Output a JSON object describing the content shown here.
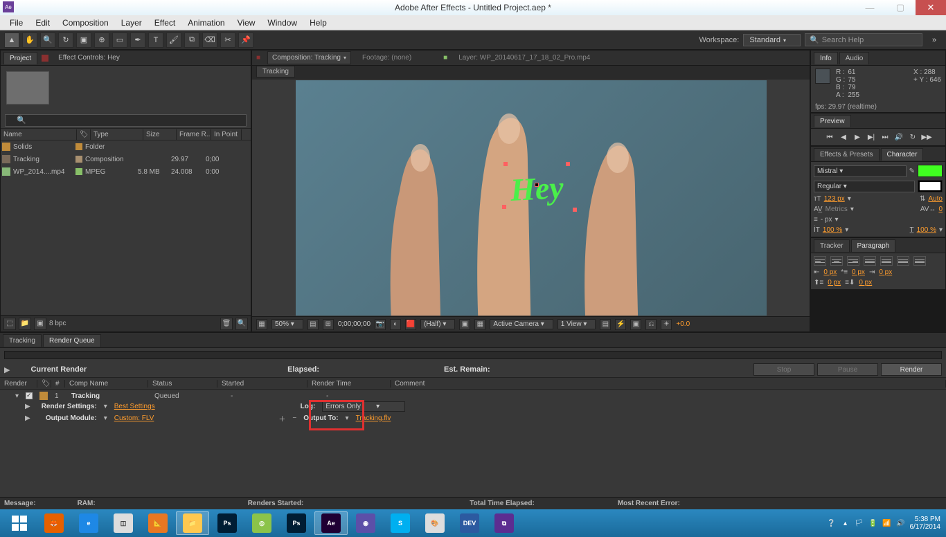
{
  "window": {
    "title": "Adobe After Effects - Untitled Project.aep *"
  },
  "menubar": [
    "File",
    "Edit",
    "Composition",
    "Layer",
    "Effect",
    "Animation",
    "View",
    "Window",
    "Help"
  ],
  "workspace": {
    "label": "Workspace:",
    "value": "Standard"
  },
  "search": {
    "placeholder": "Search Help"
  },
  "project": {
    "tabs": [
      "Project",
      "Effect Controls: Hey"
    ],
    "columns": [
      "Name",
      "",
      "Type",
      "Size",
      "Frame R...",
      "In Point"
    ],
    "rows": [
      {
        "name": "Solids",
        "type": "Folder",
        "size": "",
        "fps": "",
        "in": ""
      },
      {
        "name": "Tracking",
        "type": "Composition",
        "size": "",
        "fps": "29.97",
        "in": "0;00"
      },
      {
        "name": "WP_2014....mp4",
        "type": "MPEG",
        "size": "5.8 MB",
        "fps": "24.008",
        "in": "0:00"
      }
    ],
    "bpc": "8 bpc"
  },
  "composition": {
    "tab_label": "Composition: Tracking",
    "footage_tab": "Footage: (none)",
    "layer_tab": "Layer: WP_20140617_17_18_02_Pro.mp4",
    "breadcrumb": "Tracking",
    "overlay_text": "Hey",
    "footer": {
      "zoom": "50%",
      "time": "0;00;00;00",
      "res": "(Half)",
      "camera": "Active Camera",
      "view": "1 View",
      "exposure": "+0.0"
    }
  },
  "info": {
    "tabs": [
      "Info",
      "Audio"
    ],
    "r": "61",
    "g": "75",
    "b": "79",
    "a": "255",
    "x": "288",
    "y": "646",
    "fps": "fps: 29.97 (realtime)"
  },
  "preview": {
    "tab": "Preview"
  },
  "effects_presets": {
    "tab": "Effects & Presets"
  },
  "character": {
    "tab": "Character",
    "font": "Mistral",
    "style": "Regular",
    "size": "123 px",
    "leading": "Auto",
    "kerning": "Metrics",
    "tracking": "0",
    "stroke_w": "- px",
    "hscale": "100 %",
    "vscale": "100 %"
  },
  "tracker": {
    "tab": "Tracker"
  },
  "paragraph": {
    "tab": "Paragraph",
    "indent_left": "0 px",
    "indent_right": "0 px",
    "first_line": "0 px",
    "space_before": "0 px",
    "space_after": "0 px"
  },
  "render_queue": {
    "tabs": [
      "Tracking",
      "Render Queue"
    ],
    "current_render": "Current Render",
    "elapsed": "Elapsed:",
    "est_remain": "Est. Remain:",
    "btn_stop": "Stop",
    "btn_pause": "Pause",
    "btn_render": "Render",
    "cols": [
      "Render",
      "",
      "#",
      "Comp Name",
      "Status",
      "Started",
      "Render Time",
      "Comment"
    ],
    "item": {
      "num": "1",
      "name": "Tracking",
      "status": "Queued",
      "started": "-",
      "time": "-",
      "render_settings_lbl": "Render Settings:",
      "render_settings_val": "Best Settings",
      "output_module_lbl": "Output Module:",
      "output_module_val": "Custom: FLV",
      "log_lbl": "Log:",
      "log_val": "Errors Only",
      "output_to_lbl": "Output To:",
      "output_to_val": "Tracking.flv"
    },
    "status_bar": {
      "msg": "Message:",
      "ram": "RAM:",
      "started": "Renders Started:",
      "elapsed": "Total Time Elapsed:",
      "error": "Most Recent Error:"
    }
  },
  "taskbar": {
    "time": "5:38 PM",
    "date": "6/17/2014"
  }
}
